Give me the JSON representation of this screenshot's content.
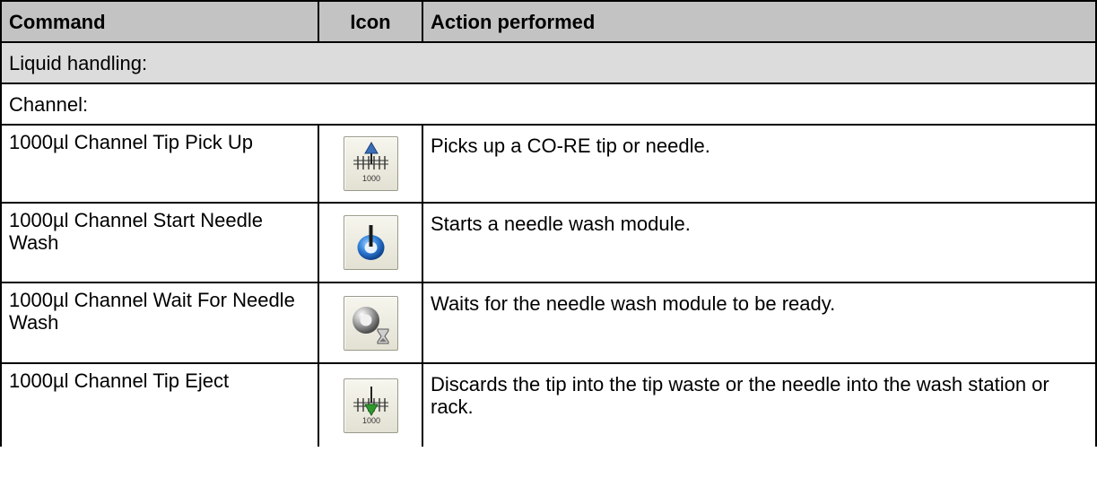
{
  "header": {
    "command": "Command",
    "icon": "Icon",
    "action": "Action performed"
  },
  "section": "Liquid handling:",
  "subsection": "Channel:",
  "rows": [
    {
      "command": "1000µl Channel Tip Pick Up",
      "icon": "tip-pick-up-icon",
      "icon_label": "1000",
      "action": "Picks up a CO-RE tip or needle."
    },
    {
      "command": "1000µl Channel Start Needle Wash",
      "icon": "start-needle-wash-icon",
      "action": "Starts a needle wash module."
    },
    {
      "command": "1000µl Channel Wait For Needle Wash",
      "icon": "wait-needle-wash-icon",
      "action": "Waits for the needle wash module to be ready."
    },
    {
      "command": "1000µl Channel Tip Eject",
      "icon": "tip-eject-icon",
      "icon_label": "1000",
      "action": "Discards the tip into the tip waste or the needle into the wash station or rack."
    }
  ],
  "colors": {
    "header_bg": "#c3c3c3",
    "section_bg": "#dcdcdc",
    "arrow_up": "#3a6fb8",
    "arrow_down": "#2e9a2e"
  }
}
